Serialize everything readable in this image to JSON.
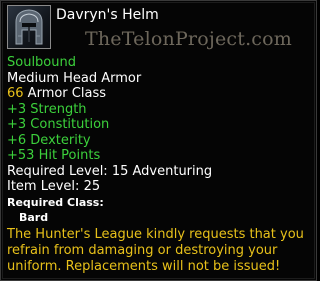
{
  "item": {
    "name": "Davryn's Helm",
    "icon": "helm-icon",
    "binding": "Soulbound",
    "type": "Medium Head Armor",
    "armor_class_value": "66",
    "armor_class_label": " Armor Class",
    "stats": [
      "+3 Strength",
      "+3 Constitution",
      "+6 Dexterity",
      "+53 Hit Points"
    ],
    "required_level_label": "Required Level: ",
    "required_level_value": "15 Adventuring",
    "item_level_label": "Item Level: ",
    "item_level_value": "25",
    "required_class_label": "Required Class:",
    "required_class_value": "Bard",
    "flavor_text": "The Hunter's League kindly requests that you refrain from damaging or destroying your uniform. Replacements will not be issued!"
  },
  "watermark": "TheTelonProject.com",
  "colors": {
    "background": "#050505",
    "stat_green": "#3cd13c",
    "value_yellow": "#e8c11a",
    "text_white": "#ffffff"
  }
}
